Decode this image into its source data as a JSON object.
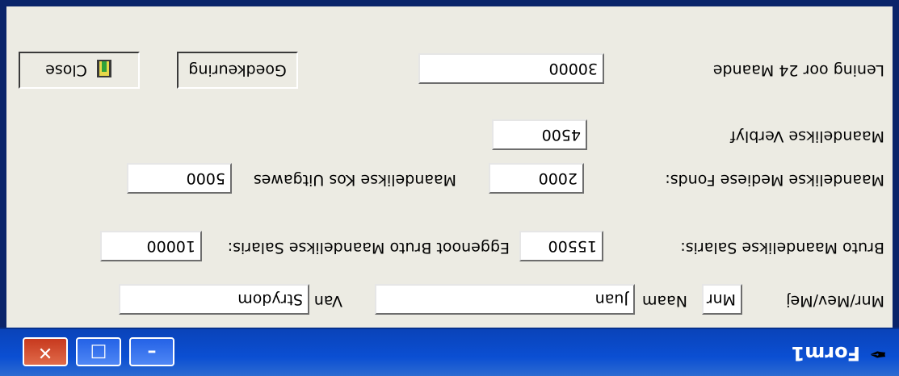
{
  "window": {
    "title": "Form1"
  },
  "form": {
    "title_label": "Mnr/Mev/Mej",
    "title_value": "Mnr",
    "name_label": "Naam",
    "name_value": "Juan",
    "surname_label": "Van",
    "surname_value": "Strydom",
    "gross_salary_label": "Bruto Maandelikse Salaris:",
    "gross_salary_value": "15500",
    "own_gross_salary_label": "Eggenoot Bruto Maandelikse Salaris:",
    "own_gross_salary_value": "10000",
    "medical_label": "Maandelikse Mediese Fonds:",
    "medical_value": "2000",
    "costs_label": "Maandelikse Kos Uitgawes",
    "costs_value": "5000",
    "rent_label": "Maandelikse Verblyf",
    "rent_value": "4500",
    "loan_label": "Lening oor 24 Maande",
    "loan_value": "30000"
  },
  "buttons": {
    "approve": "Goedkeuring",
    "close": "Close"
  },
  "colors": {
    "titlebar": "#0b4fd3",
    "close_button": "#c7391e"
  }
}
